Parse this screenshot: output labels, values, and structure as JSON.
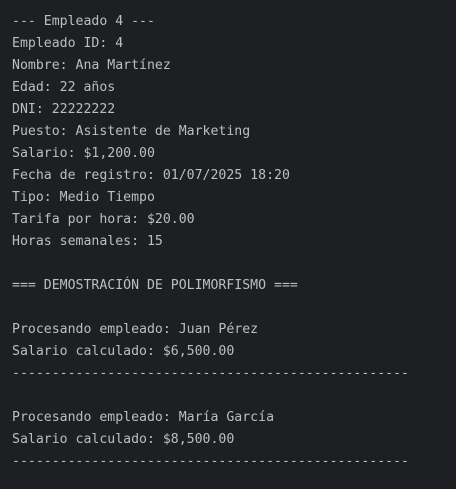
{
  "console": {
    "lines": [
      "--- Empleado 4 ---",
      "Empleado ID: 4",
      "Nombre: Ana Martínez",
      "Edad: 22 años",
      "DNI: 22222222",
      "Puesto: Asistente de Marketing",
      "Salario: $1,200.00",
      "Fecha de registro: 01/07/2025 18:20",
      "Tipo: Medio Tiempo",
      "Tarifa por hora: $20.00",
      "Horas semanales: 15",
      "",
      "=== DEMOSTRACIÓN DE POLIMORFISMO ===",
      "",
      "Procesando empleado: Juan Pérez",
      "Salario calculado: $6,500.00",
      "--------------------------------------------------",
      "",
      "Procesando empleado: María García",
      "Salario calculado: $8,500.00",
      "--------------------------------------------------"
    ]
  }
}
